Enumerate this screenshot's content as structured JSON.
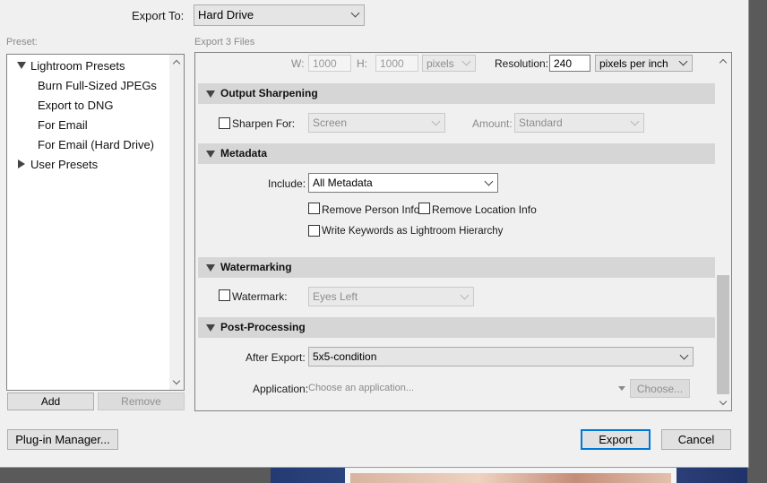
{
  "export_to": {
    "label": "Export To:",
    "value": "Hard Drive"
  },
  "preset": {
    "label": "Preset:",
    "groups": [
      {
        "label": "Lightroom Presets",
        "items": [
          "Burn Full-Sized JPEGs",
          "Export to DNG",
          "For Email",
          "For Email (Hard Drive)"
        ]
      },
      {
        "label": "User Presets"
      }
    ],
    "add_label": "Add",
    "remove_label": "Remove"
  },
  "export_files_label": "Export 3 Files",
  "sizing": {
    "w_label": "W:",
    "w_value": "1000",
    "h_label": "H:",
    "h_value": "1000",
    "unit": "pixels",
    "resolution_label": "Resolution:",
    "resolution_value": "240",
    "resolution_unit": "pixels per inch"
  },
  "output_sharpening": {
    "title": "Output Sharpening",
    "sharpen_for_label": "Sharpen For:",
    "sharpen_for_value": "Screen",
    "amount_label": "Amount:",
    "amount_value": "Standard"
  },
  "metadata": {
    "title": "Metadata",
    "include_label": "Include:",
    "include_value": "All Metadata",
    "remove_person_label": "Remove Person Info",
    "remove_location_label": "Remove Location Info",
    "write_keywords_label": "Write Keywords as Lightroom Hierarchy"
  },
  "watermarking": {
    "title": "Watermarking",
    "watermark_label": "Watermark:",
    "watermark_value": "Eyes Left"
  },
  "post_processing": {
    "title": "Post-Processing",
    "after_export_label": "After Export:",
    "after_export_value": "5x5-condition",
    "application_label": "Application:",
    "application_placeholder": "Choose an application...",
    "choose_label": "Choose..."
  },
  "footer": {
    "plugin_manager_label": "Plug-in Manager...",
    "export_label": "Export",
    "cancel_label": "Cancel"
  },
  "colors": {
    "dialog_bg": "#f0f0f0",
    "section_header": "#d6d6d6",
    "primary_border": "#0078d7"
  }
}
